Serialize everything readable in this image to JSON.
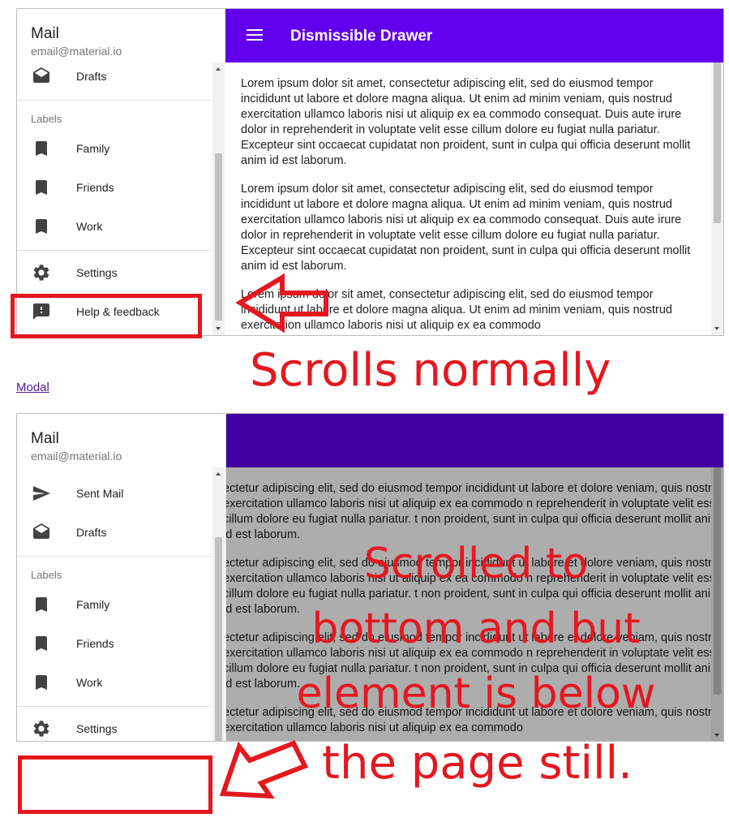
{
  "top_demo": {
    "drawer": {
      "title": "Mail",
      "subtitle": "email@material.io",
      "items": [
        {
          "label": "Drafts",
          "icon": "drafts-icon"
        },
        {
          "label": "Family",
          "icon": "bookmark-icon"
        },
        {
          "label": "Friends",
          "icon": "bookmark-icon"
        },
        {
          "label": "Work",
          "icon": "bookmark-icon"
        },
        {
          "label": "Settings",
          "icon": "settings-icon"
        },
        {
          "label": "Help & feedback",
          "icon": "feedback-icon"
        }
      ],
      "section_label": "Labels"
    },
    "appbar": {
      "title": "Dismissible Drawer",
      "menu_icon": "menu-icon",
      "color": "#6200ee"
    },
    "paragraphs": [
      "Lorem ipsum dolor sit amet, consectetur adipiscing elit, sed do eiusmod tempor incididunt ut labore et dolore magna aliqua. Ut enim ad minim veniam, quis nostrud exercitation ullamco laboris nisi ut aliquip ex ea commodo consequat. Duis aute irure dolor in reprehenderit in voluptate velit esse cillum dolore eu fugiat nulla pariatur. Excepteur sint occaecat cupidatat non proident, sunt in culpa qui officia deserunt mollit anim id est laborum.",
      "Lorem ipsum dolor sit amet, consectetur adipiscing elit, sed do eiusmod tempor incididunt ut labore et dolore magna aliqua. Ut enim ad minim veniam, quis nostrud exercitation ullamco laboris nisi ut aliquip ex ea commodo consequat. Duis aute irure dolor in reprehenderit in voluptate velit esse cillum dolore eu fugiat nulla pariatur. Excepteur sint occaecat cupidatat non proident, sunt in culpa qui officia deserunt mollit anim id est laborum.",
      "Lorem ipsum dolor sit amet, consectetur adipiscing elit, sed do eiusmod tempor incididunt ut labore et dolore magna aliqua. Ut enim ad minim veniam, quis nostrud exercitation ullamco laboris nisi ut aliquip ex ea commodo"
    ]
  },
  "modal_link": "Modal",
  "bottom_demo": {
    "drawer": {
      "title": "Mail",
      "subtitle": "email@material.io",
      "items": [
        {
          "label": "Sent Mail",
          "icon": "send-icon"
        },
        {
          "label": "Drafts",
          "icon": "drafts-icon"
        },
        {
          "label": "Family",
          "icon": "bookmark-icon"
        },
        {
          "label": "Friends",
          "icon": "bookmark-icon"
        },
        {
          "label": "Work",
          "icon": "bookmark-icon"
        },
        {
          "label": "Settings",
          "icon": "settings-icon"
        }
      ],
      "section_label": "Labels"
    },
    "paragraphs": [
      "ectetur adipiscing elit, sed do eiusmod tempor incididunt ut labore et dolore veniam, quis nostrud exercitation ullamco laboris nisi ut aliquip ex ea commodo n reprehenderit in voluptate velit esse cillum dolore eu fugiat nulla pariatur. t non proident, sunt in culpa qui officia deserunt mollit anim id est laborum.",
      "ectetur adipiscing elit, sed do eiusmod tempor incididunt ut labore et dolore veniam, quis nostrud exercitation ullamco laboris nisi ut aliquip ex ea commodo n reprehenderit in voluptate velit esse cillum dolore eu fugiat nulla pariatur. t non proident, sunt in culpa qui officia deserunt mollit anim id est laborum.",
      "ectetur adipiscing elit, sed do eiusmod tempor incididunt ut labore et dolore veniam, quis nostrud exercitation ullamco laboris nisi ut aliquip ex ea commodo n reprehenderit in voluptate velit esse cillum dolore eu fugiat nulla pariatur. t non proident, sunt in culpa qui officia deserunt mollit anim id est laborum.",
      "ectetur adipiscing elit, sed do eiusmod tempor incididunt ut labore et dolore veniam, quis nostrud exercitation ullamco laboris nisi ut aliquip ex ea commodo"
    ]
  },
  "annotations": {
    "scrolls_normally": "Scrolls normally",
    "scrolled_bottom": "Scrolled to bottom and but element is below",
    "page_still": "the page still.",
    "color": "#e5171f"
  }
}
